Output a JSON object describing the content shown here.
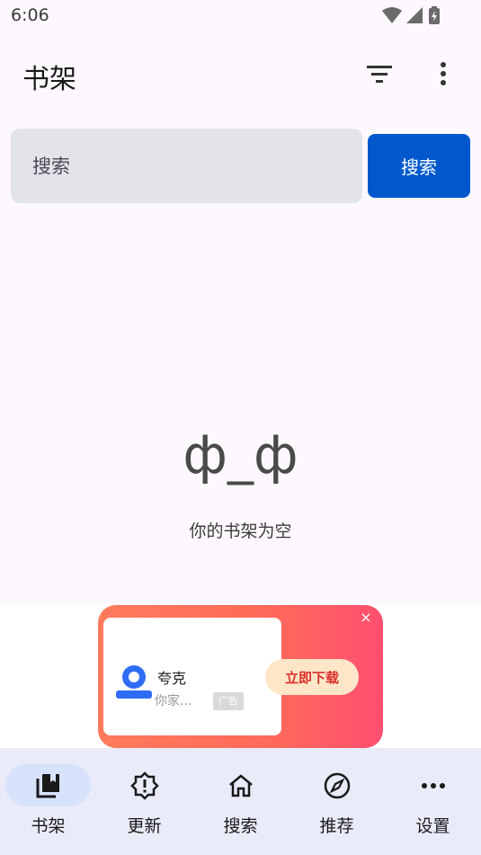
{
  "status_bar": {
    "time": "6:06",
    "icons": [
      "wifi-icon",
      "signal-icon",
      "battery-charging-icon"
    ]
  },
  "app_bar": {
    "title": "书架",
    "actions": [
      "filter-icon",
      "more-vert-icon"
    ]
  },
  "search": {
    "placeholder": "搜索",
    "value": "",
    "button_label": "搜索"
  },
  "empty_state": {
    "face": "ф_ф",
    "message": "你的书架为空"
  },
  "ad": {
    "app_name": "夸克",
    "subtitle": "你家...",
    "tag": "广告",
    "download_label": "立即下载",
    "close_icon": "close-icon",
    "colors": {
      "banner_start": "#ff7b5c",
      "banner_end": "#ff4f70",
      "button_bg": "#ffe6c8",
      "button_text": "#d9302a"
    }
  },
  "bottom_nav": {
    "items": [
      {
        "label": "书架",
        "icon": "bookshelf-icon",
        "selected": true
      },
      {
        "label": "更新",
        "icon": "update-alert-icon",
        "selected": false
      },
      {
        "label": "搜索",
        "icon": "home-icon",
        "selected": false
      },
      {
        "label": "推荐",
        "icon": "compass-icon",
        "selected": false
      },
      {
        "label": "设置",
        "icon": "more-horiz-icon",
        "selected": false
      }
    ]
  },
  "colors": {
    "accent": "#0058cc",
    "background": "#fcf8fd",
    "nav_background": "#e9ebf8",
    "nav_selected": "#d7e2fb"
  }
}
